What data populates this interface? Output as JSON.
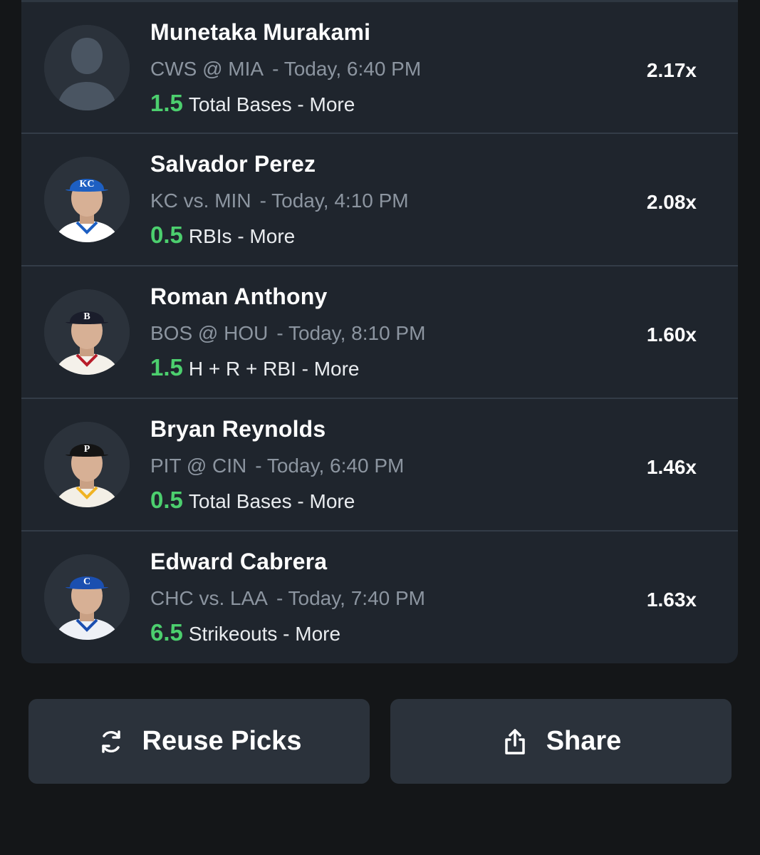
{
  "picks": [
    {
      "player": "Munetaka Murakami",
      "matchup": "CWS @ MIA",
      "time": "- Today, 6:40 PM",
      "line": "1.5",
      "prop": "Total Bases - More",
      "multiplier": "2.17x",
      "avatar": "placeholder-silhouette-icon"
    },
    {
      "player": "Salvador Perez",
      "matchup": "KC vs. MIN",
      "time": "- Today, 4:10 PM",
      "line": "0.5",
      "prop": "RBIs - More",
      "multiplier": "2.08x",
      "avatar": "player-headshot",
      "cap_color": "#1d5fc2",
      "cap_letter": "KC",
      "jersey_color": "#ffffff",
      "jersey_trim": "#1d5fc2"
    },
    {
      "player": "Roman Anthony",
      "matchup": "BOS @ HOU",
      "time": "- Today, 8:10 PM",
      "line": "1.5",
      "prop": "H + R + RBI - More",
      "multiplier": "1.60x",
      "avatar": "player-headshot",
      "cap_color": "#1a1d2b",
      "cap_letter": "B",
      "jersey_color": "#f4f1ea",
      "jersey_trim": "#b81d2a"
    },
    {
      "player": "Bryan Reynolds",
      "matchup": "PIT @ CIN",
      "time": "- Today, 6:40 PM",
      "line": "0.5",
      "prop": "Total Bases - More",
      "multiplier": "1.46x",
      "avatar": "player-headshot",
      "cap_color": "#141414",
      "cap_letter": "P",
      "jersey_color": "#f3efe6",
      "jersey_trim": "#f0b323"
    },
    {
      "player": "Edward Cabrera",
      "matchup": "CHC vs. LAA",
      "time": "- Today, 7:40 PM",
      "line": "6.5",
      "prop": "Strikeouts - More",
      "multiplier": "1.63x",
      "avatar": "player-headshot",
      "cap_color": "#1b4fb0",
      "cap_letter": "C",
      "jersey_color": "#eef1f6",
      "jersey_trim": "#1b4fb0"
    }
  ],
  "actions": {
    "reuse_label": "Reuse Picks",
    "reuse_icon": "refresh-icon",
    "share_label": "Share",
    "share_icon": "share-icon"
  },
  "colors": {
    "background": "#141618",
    "card": "#1f252d",
    "line_value": "#4ccf6e",
    "secondary_text": "#8c95a0",
    "button": "#2b323b"
  }
}
